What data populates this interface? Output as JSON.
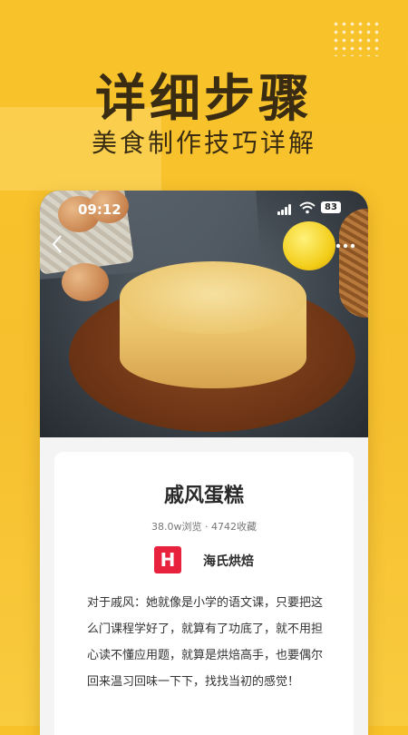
{
  "banner": {
    "headline": "详细步骤",
    "subheadline": "美食制作技巧详解"
  },
  "status_bar": {
    "time": "09:12",
    "battery": "83"
  },
  "nav": {
    "back_icon": "chevron-left-icon",
    "more_icon": "more-dots-icon"
  },
  "recipe": {
    "title": "戚风蛋糕",
    "stats": "38.0w浏览 · 4742收藏",
    "author": {
      "logo_letter": "H",
      "name": "海氏烘焙",
      "logo_color": "#e8213c"
    },
    "description": "对于戚风：她就像是小学的语文课，只要把这么门课程学好了，就算有了功底了，就不用担心读不懂应用题，就算是烘焙高手，也要偶尔回来温习回味一下下，找找当初的感觉！"
  },
  "colors": {
    "background": "#f8c32a",
    "text_dark": "#3a2c12"
  }
}
